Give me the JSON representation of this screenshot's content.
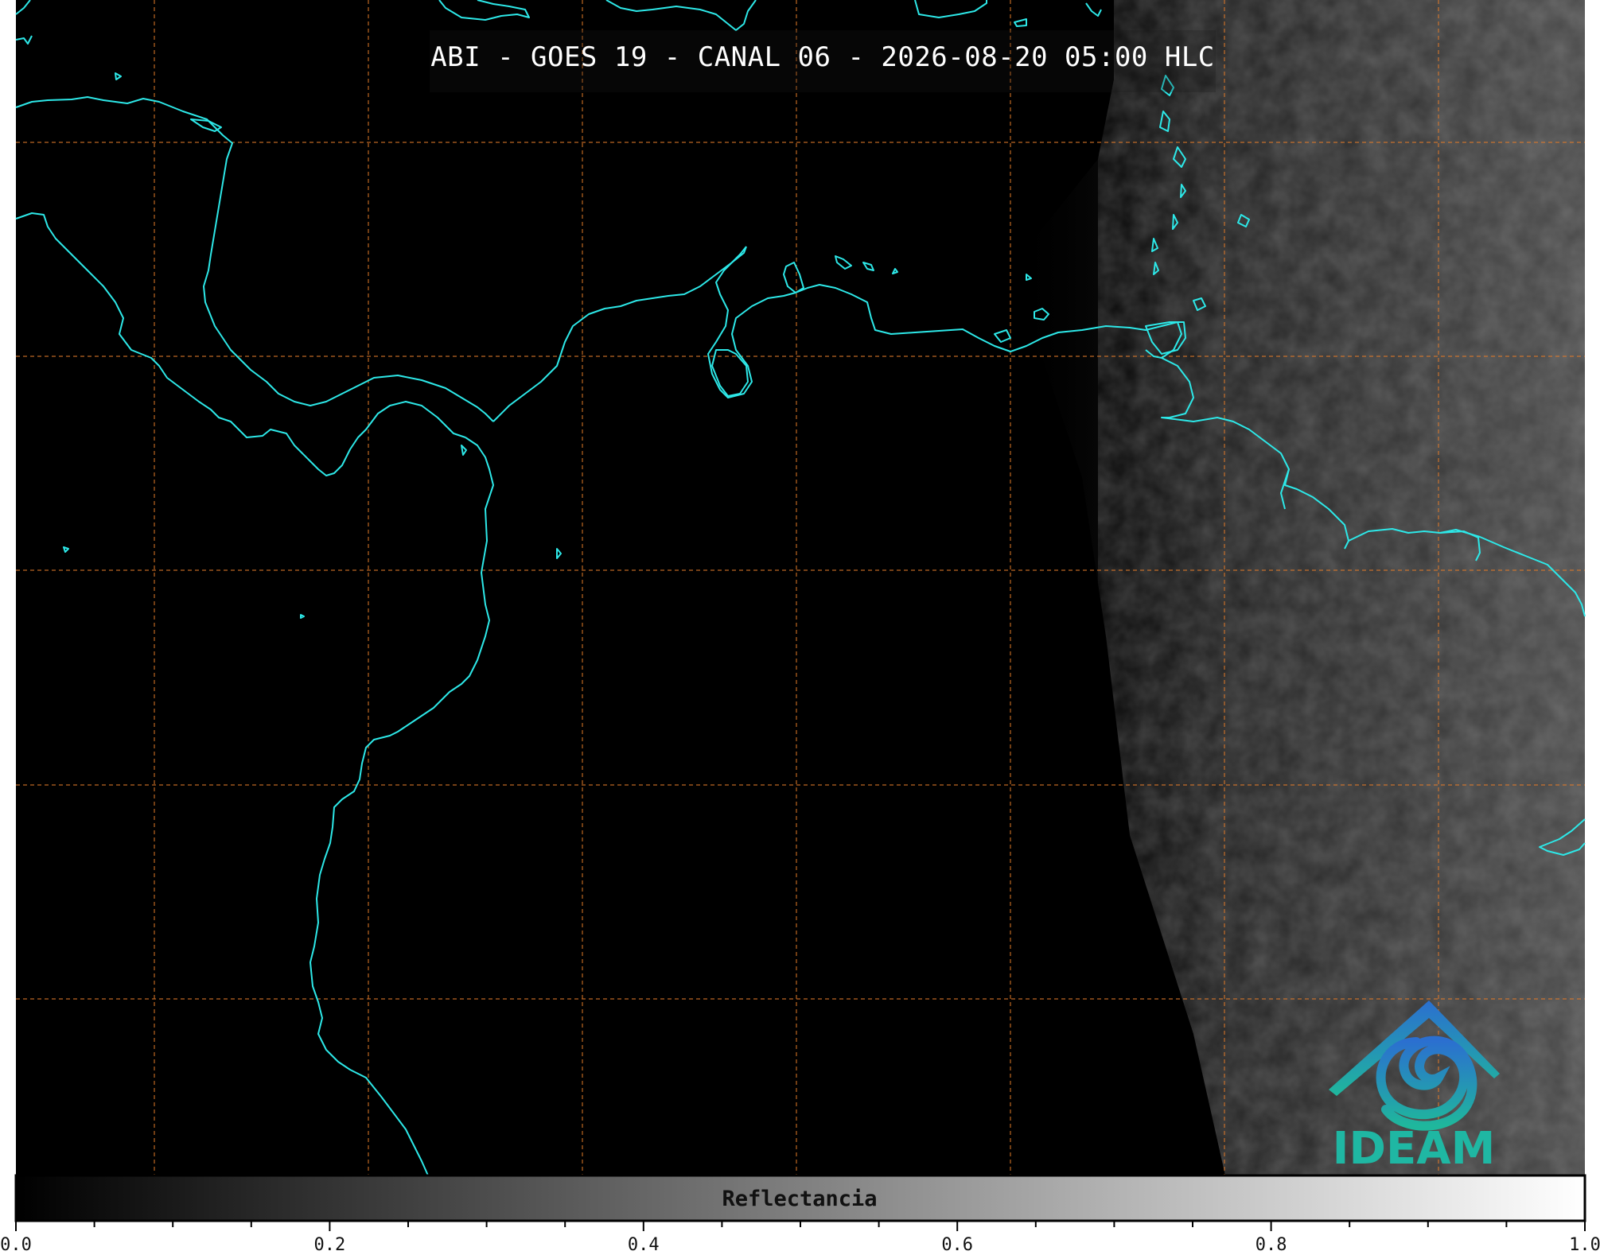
{
  "title": "ABI - GOES 19 - CANAL 06 - 2026-08-20 05:00 HLC",
  "logo": {
    "text": "IDEAM"
  },
  "colorbar": {
    "label": "Reflectancia",
    "ticks": [
      "0.0",
      "0.2",
      "0.4",
      "0.6",
      "0.8",
      "1.0"
    ],
    "range": [
      0.0,
      1.0
    ]
  },
  "colors": {
    "coastline": "#2de8e8",
    "gridline": "#e07a2a",
    "background": "#000000"
  }
}
